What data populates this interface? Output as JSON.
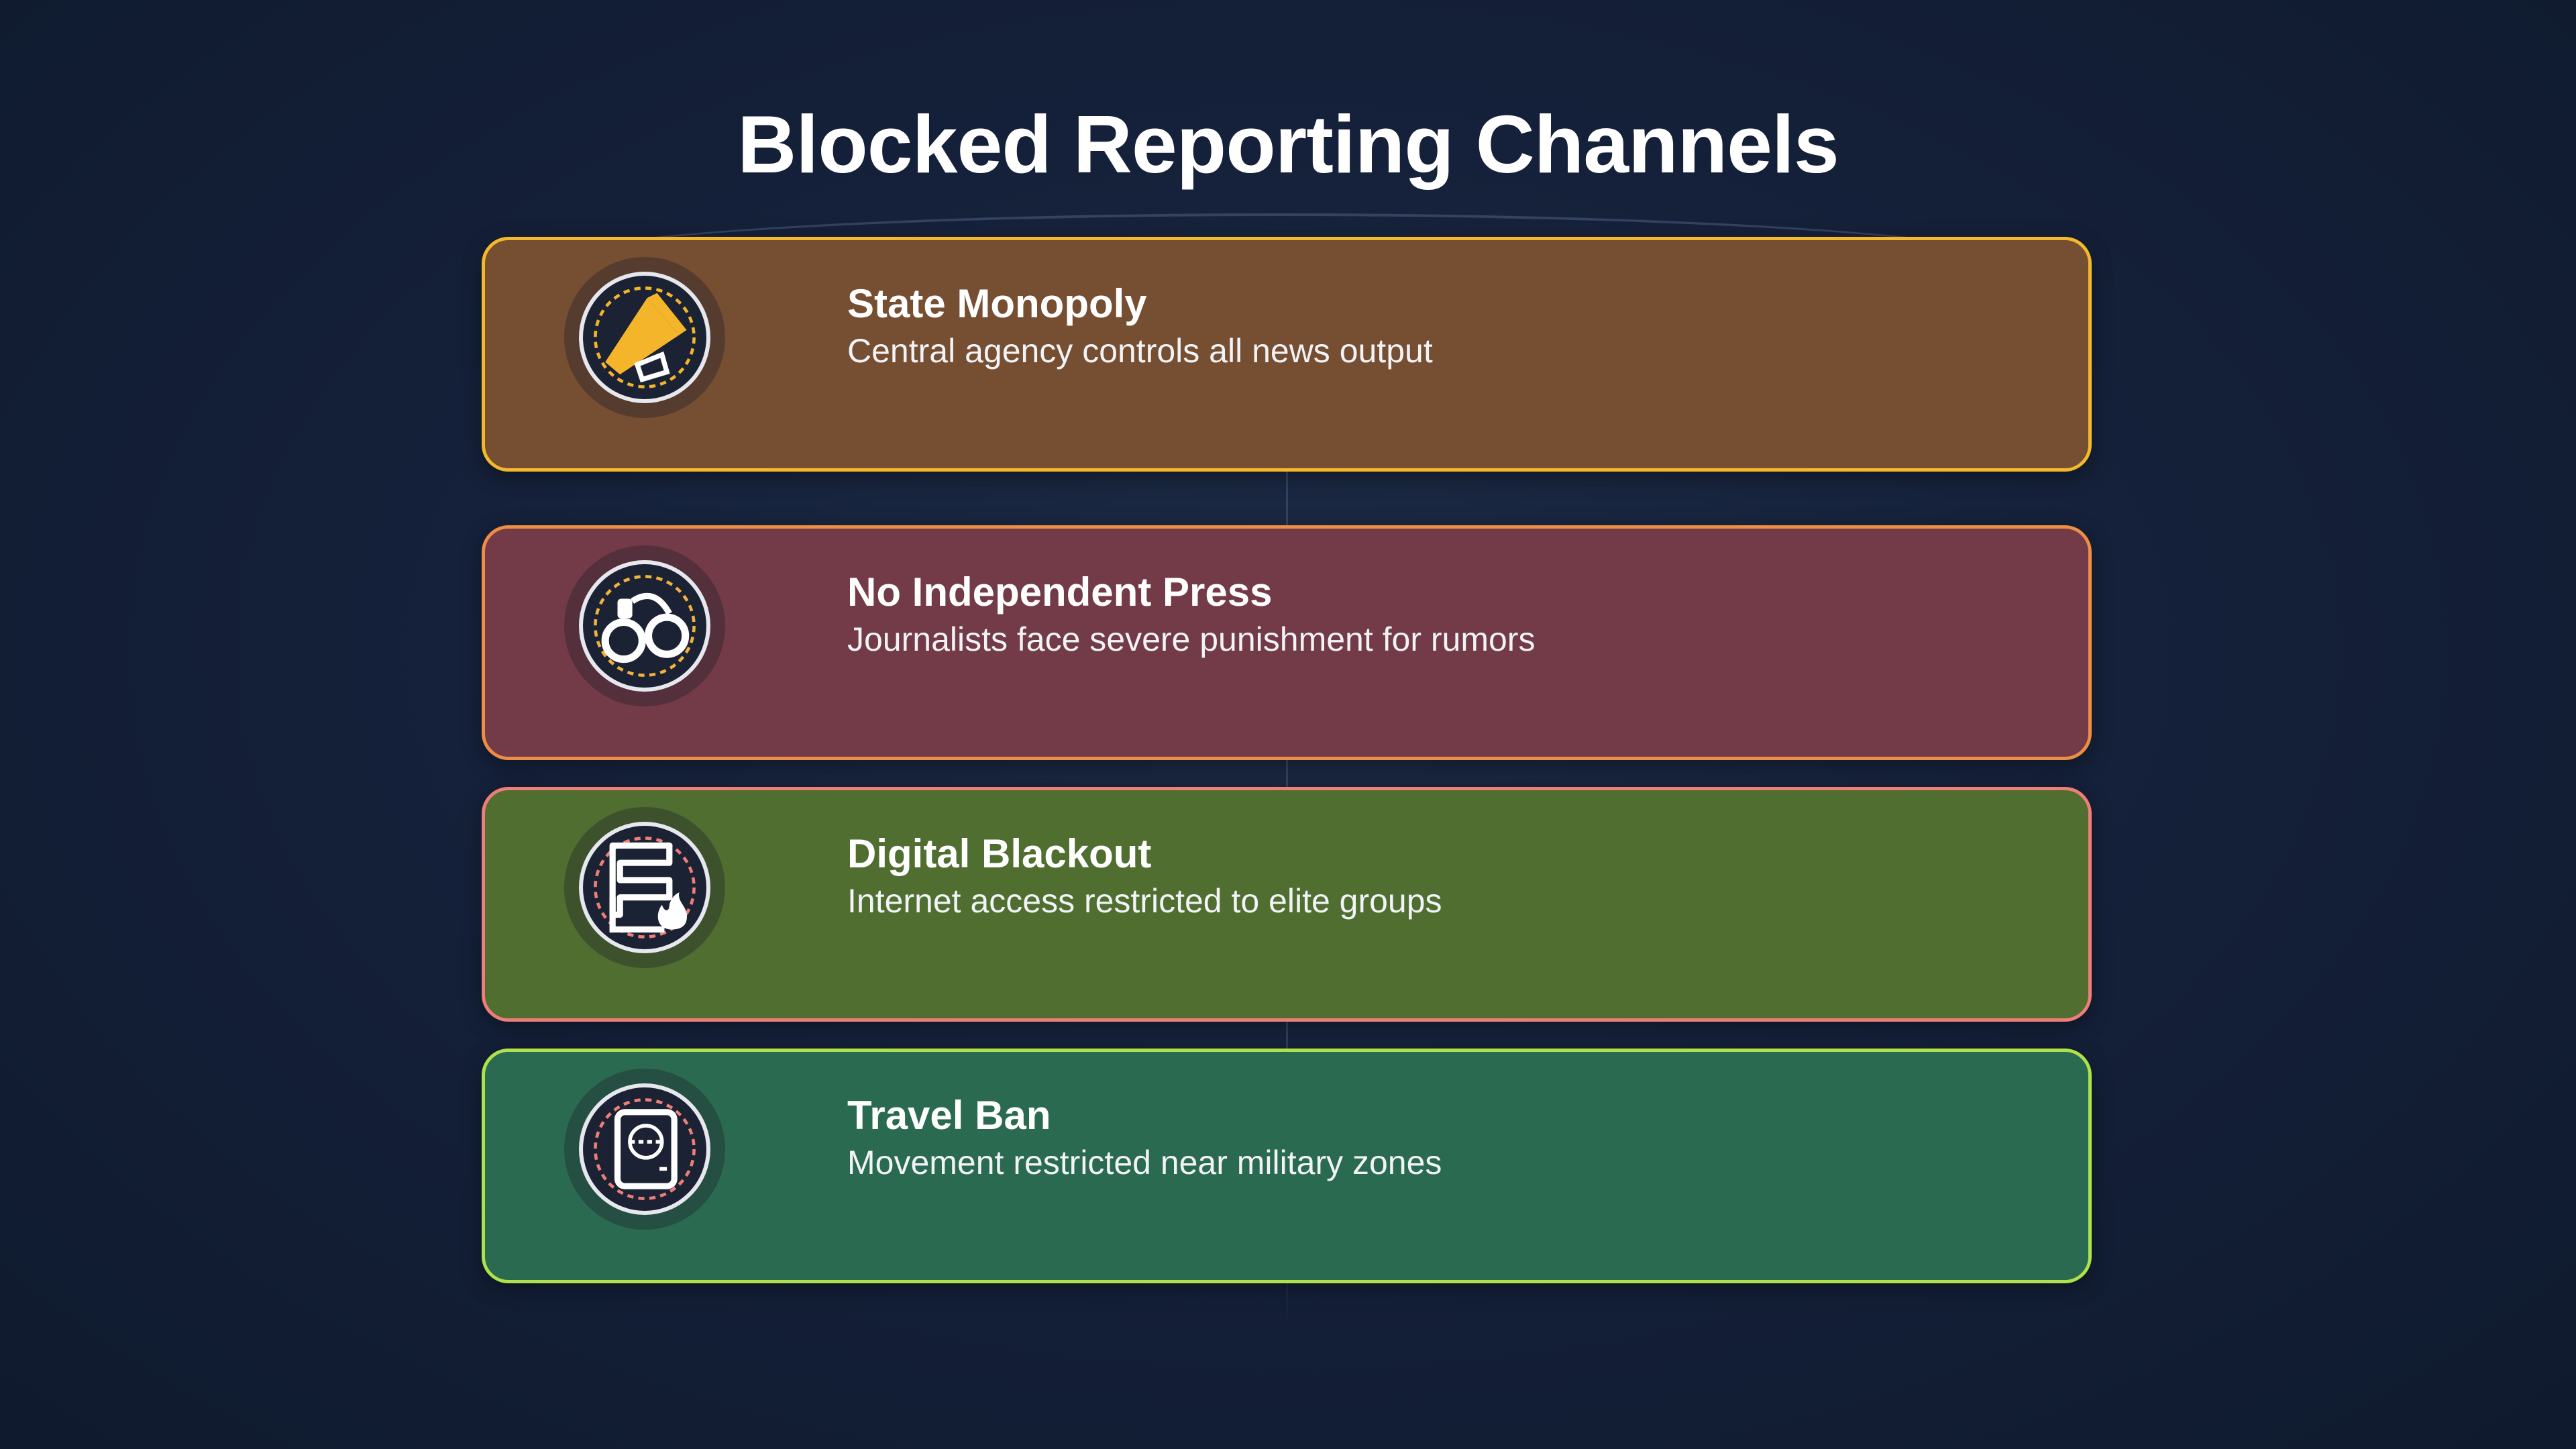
{
  "page": {
    "title": "Blocked Reporting Channels"
  },
  "cards": [
    {
      "title": "State Monopoly",
      "description": "Central agency controls all news output",
      "icon": "megaphone-icon",
      "fill": "#764e32",
      "border": "#f3b92a",
      "accent": "#f5b52b"
    },
    {
      "title": "No Independent Press",
      "description": "Journalists face severe punishment for rumors",
      "icon": "handcuffs-icon",
      "fill": "#723b47",
      "border": "#ee8d45",
      "accent": "#f0b23c"
    },
    {
      "title": "Digital Blackout",
      "description": "Internet access restricted to elite groups",
      "icon": "burning-document-icon",
      "fill": "#4f6e30",
      "border": "#ef7e78",
      "accent": "#ef7e78"
    },
    {
      "title": "Travel Ban",
      "description": "Movement restricted near military zones",
      "icon": "passport-icon",
      "fill": "#2a6a50",
      "border": "#aee24a",
      "accent": "#ef7e78"
    }
  ]
}
